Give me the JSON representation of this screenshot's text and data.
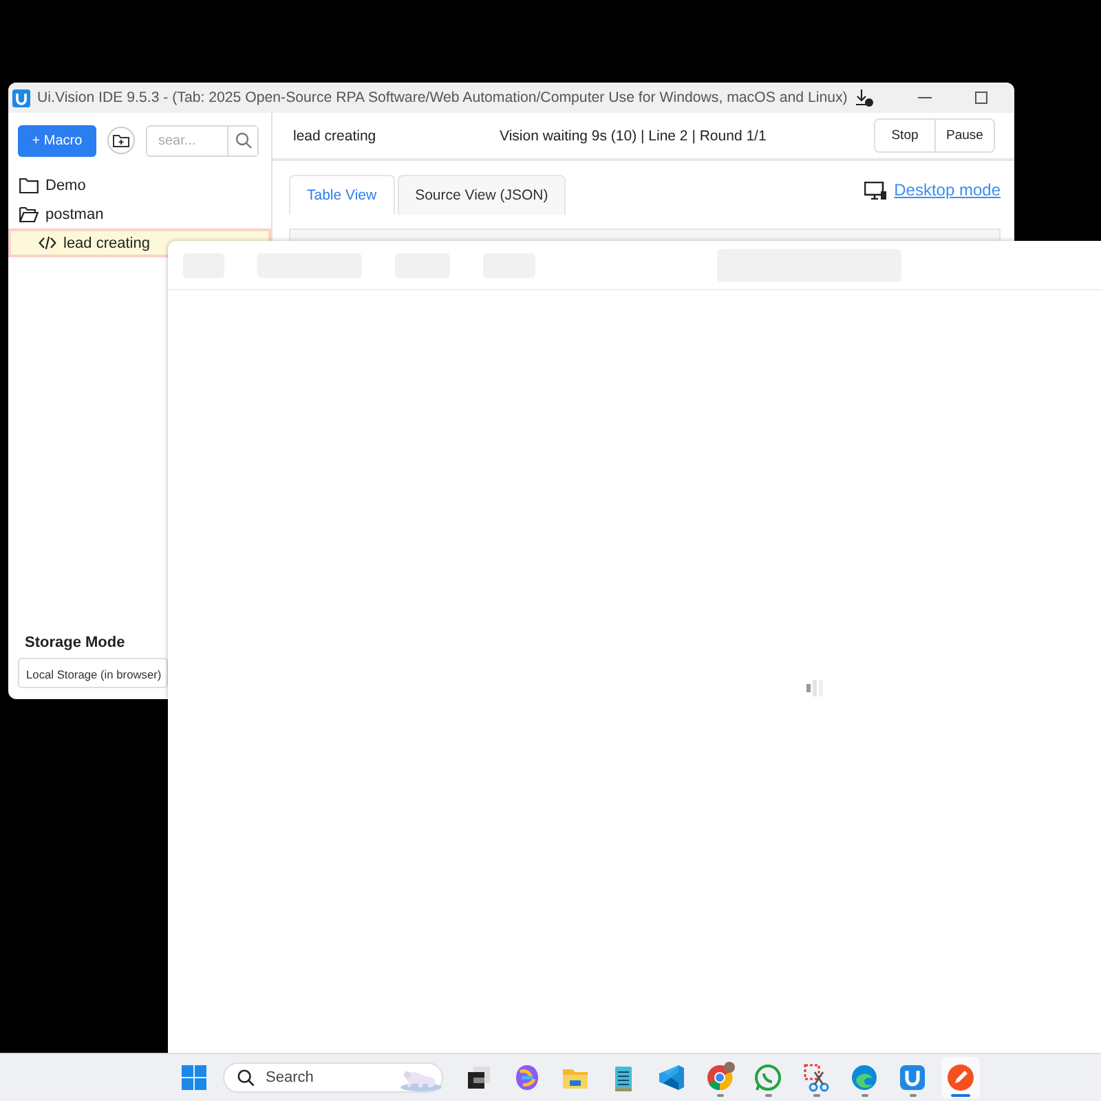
{
  "window": {
    "title": "Ui.Vision IDE 9.5.3 - (Tab: 2025 Open-Source RPA Software/Web Automation/Computer Use for Windows, macOS and Linux)"
  },
  "sidebar": {
    "add_button": "+ Macro",
    "search": {
      "placeholder": "sear..."
    },
    "tree": [
      {
        "label": "Demo",
        "kind": "folder",
        "expanded": false,
        "selected": false
      },
      {
        "label": "postman",
        "kind": "folder",
        "expanded": true,
        "selected": false,
        "children": [
          {
            "label": "lead creating",
            "kind": "macro",
            "selected": true
          }
        ]
      }
    ],
    "storage": {
      "label": "Storage Mode",
      "value": "Local Storage (in browser)"
    }
  },
  "header": {
    "macro_name": "lead creating",
    "status": "Vision waiting 9s (10) | Line 2 | Round 1/1",
    "buttons": [
      "Stop",
      "Pause"
    ]
  },
  "tabs": [
    {
      "label": "Table View",
      "selected": true
    },
    {
      "label": "Source View (JSON)",
      "selected": false
    }
  ],
  "desktop_mode_link": "Desktop mode",
  "overlay": {
    "loading": true
  },
  "taskbar": {
    "search": {
      "placeholder": "Search"
    },
    "apps": [
      {
        "kind": "windows",
        "running": false,
        "selected": false
      },
      {
        "kind": "gallery",
        "running": false,
        "selected": false
      },
      {
        "kind": "sparkle",
        "running": false,
        "selected": false
      },
      {
        "kind": "folder",
        "running": false,
        "selected": false
      },
      {
        "kind": "notepad",
        "running": false,
        "selected": false
      },
      {
        "kind": "code",
        "running": false,
        "selected": false
      },
      {
        "kind": "browser",
        "running": true,
        "selected": false
      },
      {
        "kind": "chat",
        "running": true,
        "selected": false
      },
      {
        "kind": "snip",
        "running": true,
        "selected": false
      },
      {
        "kind": "wave",
        "running": true,
        "selected": false
      },
      {
        "kind": "uapp",
        "running": true,
        "selected": false
      },
      {
        "kind": "pen",
        "running": true,
        "selected": true
      }
    ]
  }
}
